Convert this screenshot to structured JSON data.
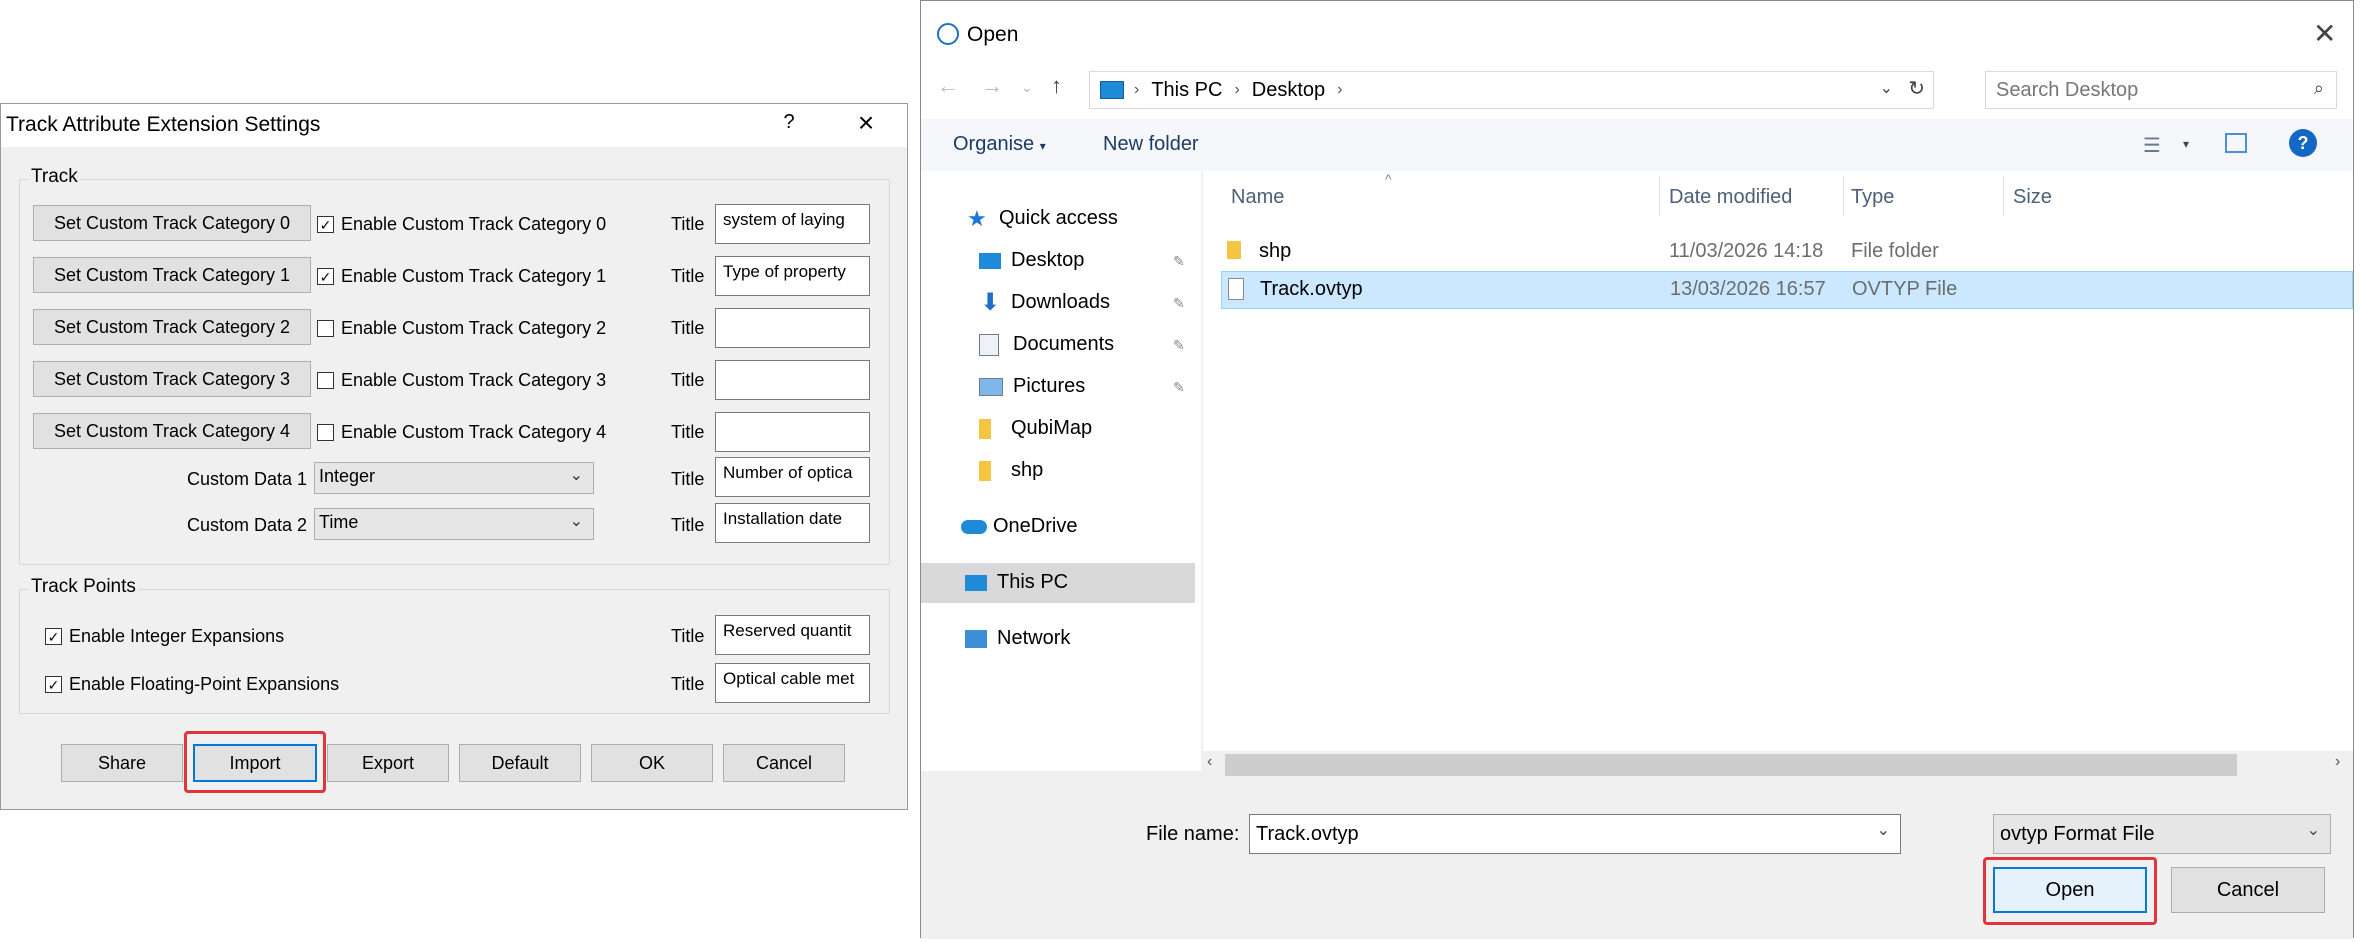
{
  "settings_dialog": {
    "title": "Track Attribute Extension Settings",
    "help_glyph": "?",
    "close_glyph": "×",
    "track_group": {
      "label": "Track",
      "title_label": "Title",
      "categories": [
        {
          "button": "Set Custom Track Category 0",
          "checkbox": "Enable Custom Track Category 0",
          "checked": true,
          "title_value": "system of laying"
        },
        {
          "button": "Set Custom Track Category 1",
          "checkbox": "Enable Custom Track Category 1",
          "checked": true,
          "title_value": "Type of property"
        },
        {
          "button": "Set Custom Track Category 2",
          "checkbox": "Enable Custom Track Category 2",
          "checked": false,
          "title_value": ""
        },
        {
          "button": "Set Custom Track Category 3",
          "checkbox": "Enable Custom Track Category 3",
          "checked": false,
          "title_value": ""
        },
        {
          "button": "Set Custom Track Category 4",
          "checkbox": "Enable Custom Track Category 4",
          "checked": false,
          "title_value": ""
        }
      ],
      "custom_data": [
        {
          "label": "Custom Data 1",
          "type": "Integer",
          "title_value": "Number of optica"
        },
        {
          "label": "Custom Data 2",
          "type": "Time",
          "title_value": "Installation date"
        }
      ]
    },
    "points_group": {
      "label": "Track Points",
      "title_label": "Title",
      "items": [
        {
          "checkbox": "Enable Integer Expansions",
          "checked": true,
          "title_value": "Reserved quantit"
        },
        {
          "checkbox": "Enable Floating-Point Expansions",
          "checked": true,
          "title_value": "Optical cable met"
        }
      ]
    },
    "buttons": {
      "share": "Share",
      "import": "Import",
      "export": "Export",
      "default": "Default",
      "ok": "OK",
      "cancel": "Cancel"
    }
  },
  "open_dialog": {
    "title": "Open",
    "close_glyph": "✕",
    "breadcrumb": [
      "This PC",
      "Desktop"
    ],
    "search_placeholder": "Search Desktop",
    "commands": {
      "organise": "Organise",
      "new_folder": "New folder"
    },
    "nav": {
      "quick_access": "Quick access",
      "quick_items": [
        {
          "label": "Desktop",
          "icon": "desktop-icon",
          "pinned": true
        },
        {
          "label": "Downloads",
          "icon": "downloads-icon",
          "pinned": true
        },
        {
          "label": "Documents",
          "icon": "documents-icon",
          "pinned": true
        },
        {
          "label": "Pictures",
          "icon": "pictures-icon",
          "pinned": true
        },
        {
          "label": "QubiMap",
          "icon": "folder-icon",
          "pinned": false
        },
        {
          "label": "shp",
          "icon": "folder-icon",
          "pinned": false
        }
      ],
      "onedrive": "OneDrive",
      "this_pc": "This PC",
      "network": "Network"
    },
    "columns": {
      "name": "Name",
      "date_modified": "Date modified",
      "type": "Type",
      "size": "Size"
    },
    "files": [
      {
        "name": "shp",
        "date": "11/03/2026 14:18",
        "type": "File folder",
        "icon": "folder-icon",
        "selected": false
      },
      {
        "name": "Track.ovtyp",
        "date": "13/03/2026 16:57",
        "type": "OVTYP File",
        "icon": "file-icon",
        "selected": true
      }
    ],
    "footer": {
      "file_name_label": "File name:",
      "file_name_value": "Track.ovtyp",
      "file_type_value": "ovtyp Format File",
      "open_label": "Open",
      "cancel_label": "Cancel"
    },
    "colors": {
      "selection": "#cce8ff",
      "accent": "#0078d7",
      "highlight": "#e0353b"
    }
  }
}
